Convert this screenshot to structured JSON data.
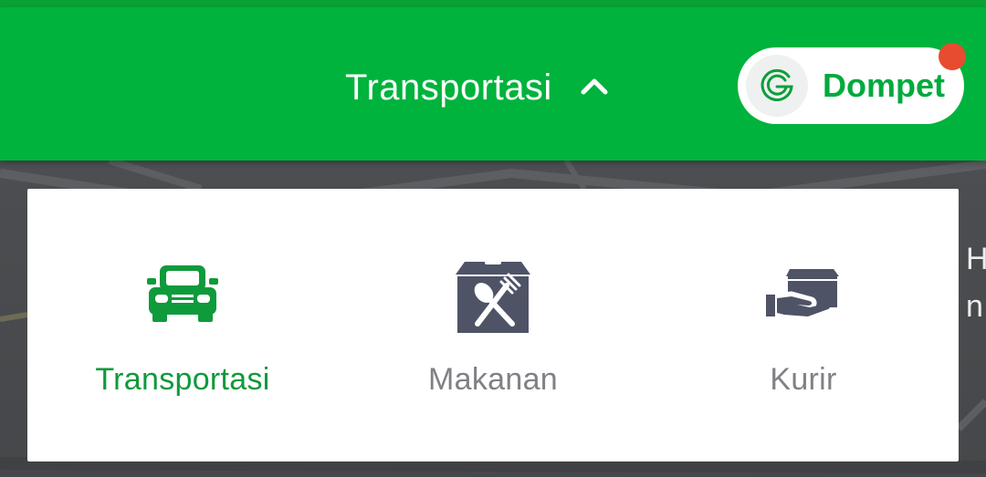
{
  "colors": {
    "brand_green": "#00b33c",
    "active_green": "#0f9a3c",
    "inactive_gray": "#808186",
    "icon_gray": "#4e5366",
    "badge_red": "#e74c2f"
  },
  "header": {
    "title": "Transportasi",
    "toggle_icon": "chevron-up-icon"
  },
  "wallet": {
    "logo_letter": "G",
    "label": "Dompet",
    "has_notification": true
  },
  "services": [
    {
      "label": "Transportasi",
      "icon": "car-icon",
      "active": true
    },
    {
      "label": "Makanan",
      "icon": "food-box-icon",
      "active": false
    },
    {
      "label": "Kurir",
      "icon": "courier-package-icon",
      "active": false
    }
  ],
  "background_edge_text": [
    "H",
    "n"
  ]
}
